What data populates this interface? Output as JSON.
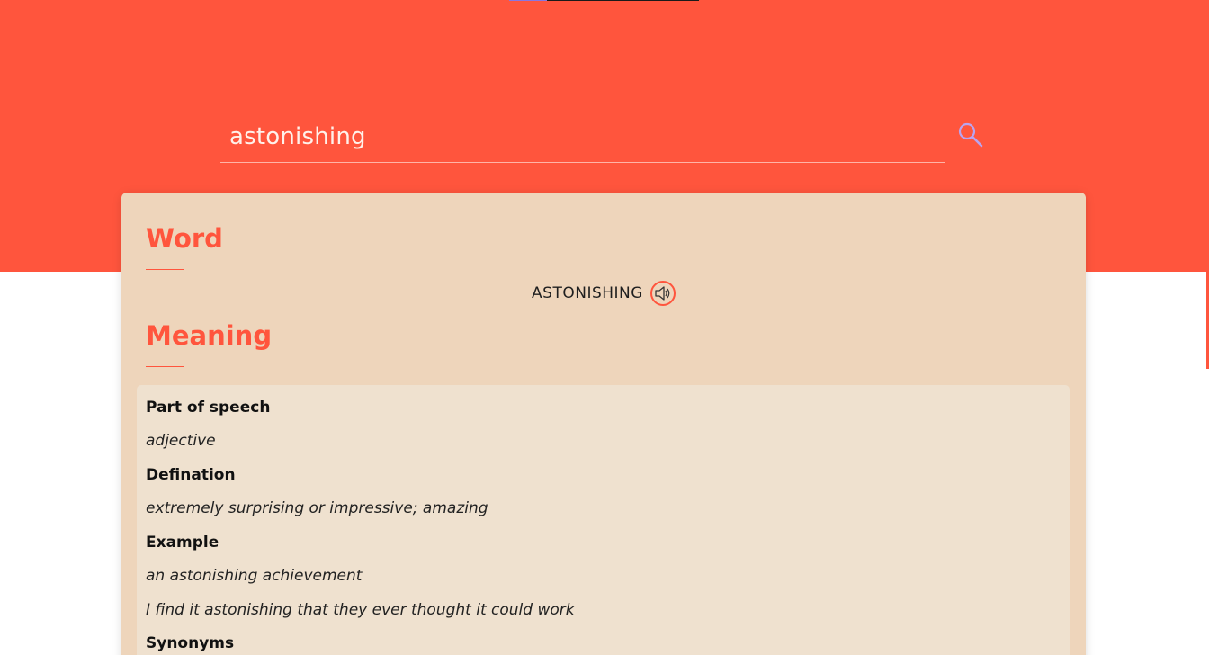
{
  "search": {
    "value": "astonishing",
    "placeholder": ""
  },
  "icons": {
    "search": "search-icon",
    "speaker": "speaker-icon"
  },
  "colors": {
    "accent": "#ff553d",
    "card": "#eed5bb",
    "meaning_box": "#efe1cf"
  },
  "word_section": {
    "title": "Word",
    "word": "ASTONISHING"
  },
  "meaning_section": {
    "title": "Meaning",
    "part_of_speech_label": "Part of speech",
    "part_of_speech": "adjective",
    "definition_label": "Defination",
    "definition": "extremely surprising or impressive; amazing",
    "example_label": "Example",
    "examples": [
      "an astonishing achievement",
      "I find it astonishing that they ever thought it could work"
    ],
    "synonyms_label": "Synonyms"
  }
}
